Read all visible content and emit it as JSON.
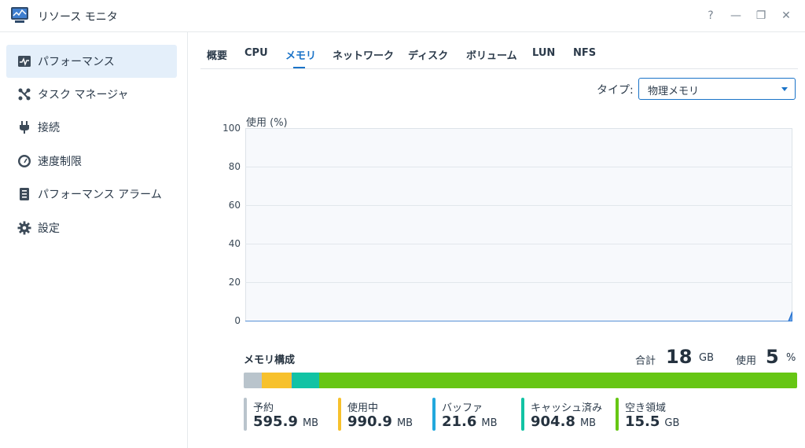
{
  "window": {
    "title": "リソース モニタ",
    "help": "?",
    "minimize": "—",
    "restore": "❐",
    "close": "✕"
  },
  "sidebar": {
    "items": [
      {
        "label": "パフォーマンス",
        "icon": "performance-chart-icon",
        "active": true
      },
      {
        "label": "タスク マネージャ",
        "icon": "task-manager-icon"
      },
      {
        "label": "接続",
        "icon": "plug-icon"
      },
      {
        "label": "速度制限",
        "icon": "speedometer-icon"
      },
      {
        "label": "パフォーマンス アラーム",
        "icon": "alarm-list-icon"
      },
      {
        "label": "設定",
        "icon": "gear-icon"
      }
    ]
  },
  "tabs": [
    "概要",
    "CPU",
    "メモリ",
    "ネットワーク",
    "ディスク",
    "ボリューム",
    "LUN",
    "NFS"
  ],
  "active_tab": "メモリ",
  "type_filter": {
    "label": "タイプ:",
    "value": "物理メモリ"
  },
  "chart_data": {
    "type": "area",
    "ylabel": "使用 (%)",
    "ylim": [
      0,
      100
    ],
    "yticks": [
      "100",
      "80",
      "60",
      "40",
      "20",
      "0"
    ],
    "grid": true,
    "series": [
      {
        "values": [
          0,
          0,
          5
        ]
      }
    ]
  },
  "memory": {
    "title": "メモリ構成",
    "total_label": "合計",
    "total_value": "18",
    "total_unit": "GB",
    "used_label": "使用",
    "used_value": "5",
    "used_unit": "%",
    "breakdown": [
      {
        "name": "予約",
        "value": "595.9",
        "unit": "MB",
        "color": "#b9c4cc",
        "fraction": 0.032
      },
      {
        "name": "使用中",
        "value": "990.9",
        "unit": "MB",
        "color": "#f7c12c",
        "fraction": 0.054
      },
      {
        "name": "バッファ",
        "value": "21.6",
        "unit": "MB",
        "color": "#22a8dd",
        "fraction": 0.0012
      },
      {
        "name": "キャッシュ済み",
        "value": "904.8",
        "unit": "MB",
        "color": "#12c3a4",
        "fraction": 0.049
      },
      {
        "name": "空き領域",
        "value": "15.5",
        "unit": "GB",
        "color": "#66c614",
        "fraction": 0.864
      }
    ]
  }
}
